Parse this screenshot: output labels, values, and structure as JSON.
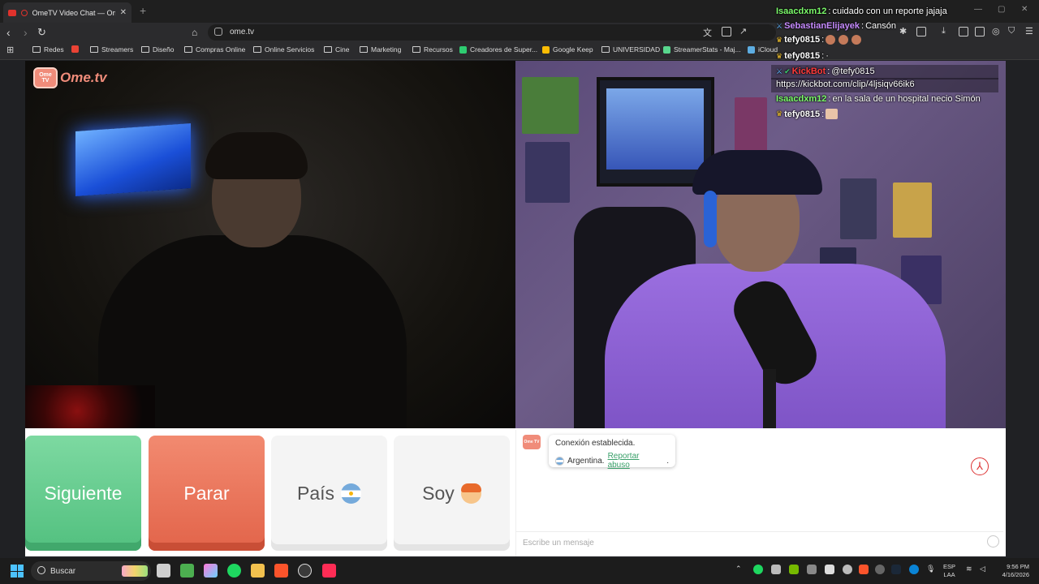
{
  "browser": {
    "tab_title": "OmeTV Video Chat — Omegle",
    "url": "ome.tv",
    "bookmarks": [
      "Redes",
      "Streamers",
      "Diseño",
      "Compras Online",
      "Online Servicios",
      "Cine",
      "Marketing",
      "Recursos",
      "Creadores de Super...",
      "Google Keep",
      "UNIVERSIDAD",
      "StreamerStats - Maj...",
      "iCloud"
    ]
  },
  "page": {
    "logo_box": "Ome TV",
    "logo_word": "Ome.tv",
    "buttons": {
      "next": "Siguiente",
      "stop": "Parar",
      "country": "País",
      "gender": "Soy"
    },
    "chat": {
      "system_logo": "Ome TV",
      "status": "Conexión establecida.",
      "country": "Argentina.",
      "report": "Reportar abuso",
      "report_end": ".",
      "placeholder": "Escribe un mensaje"
    }
  },
  "stream_chat": [
    {
      "user": "Isaacdxm12",
      "user_color": "#7cfc6b",
      "text": "cuidado con un reporte jajaja"
    },
    {
      "user": "SebastianElijayek",
      "user_color": "#c78bff",
      "text": "Cansón"
    },
    {
      "user": "tefy0815",
      "user_color": "#ffffff",
      "text": ""
    },
    {
      "user": "tefy0815",
      "user_color": "#ffffff",
      "text": "·"
    },
    {
      "user": "KickBot",
      "user_color": "#ff3b3b",
      "text": "@tefy0815"
    },
    {
      "user": "",
      "user_color": "#ffffff",
      "text": "https://kickbot.com/clip/4ljsiqv66ik6"
    },
    {
      "user": "Isaacdxm12",
      "user_color": "#7cfc6b",
      "text": "en la sala de un hospital necio Simón"
    },
    {
      "user": "tefy0815",
      "user_color": "#ffffff",
      "text": ""
    }
  ],
  "taskbar": {
    "search": "Buscar",
    "lang_top": "ESP",
    "lang_bottom": "LAA",
    "time": "9:56 PM",
    "date": "4/16/2026"
  },
  "colors": {
    "next": "#5fcb8c",
    "stop": "#ea7358",
    "brand": "#f08c7a",
    "report_link": "#3aa06a"
  }
}
